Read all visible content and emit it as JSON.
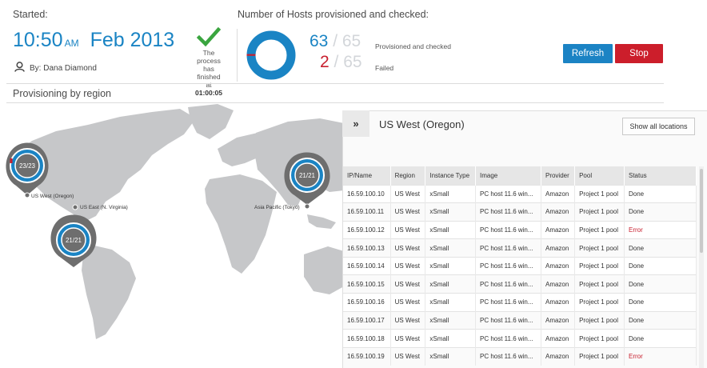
{
  "header": {
    "started_label": "Started:",
    "hosts_label": "Number of Hosts provisioned and checked:",
    "time": "10:50",
    "ampm": "AM",
    "date": "Feb 2013",
    "user": "By: Dana Diamond",
    "finished_line1": "The process",
    "finished_line2": "has finished",
    "finished_line3_prefix": "at",
    "finished_time": "01:00:05"
  },
  "hosts": {
    "provisioned": "63",
    "provisioned_total": "/ 65",
    "provisioned_label": "Provisioned and checked",
    "failed": "2",
    "failed_total": "/ 65",
    "failed_label": "Failed",
    "donut_fraction": 0.969
  },
  "buttons": {
    "refresh": "Refresh",
    "stop": "Stop"
  },
  "section": {
    "provisioning_title": "Provisioning by region"
  },
  "map": {
    "pins": [
      {
        "count": "23/23",
        "label": "US West (Oregon)"
      },
      {
        "count": "21/21",
        "label": "US East (N. Virginia)"
      },
      {
        "count": "21/21",
        "label": "Asia Pacific (Tokyo)"
      }
    ]
  },
  "panel": {
    "expand_glyph": "»",
    "title": "US West (Oregon)",
    "show_all": "Show all locations",
    "columns": [
      "IP/Name",
      "Region",
      "Instance Type",
      "Image",
      "Provider",
      "Pool",
      "Status"
    ],
    "rows": [
      [
        "16.59.100.10",
        "US West",
        "xSmall",
        "PC host 11.6 win...",
        "Amazon",
        "Project 1 pool",
        "Done"
      ],
      [
        "16.59.100.11",
        "US West",
        "xSmall",
        "PC host 11.6 win...",
        "Amazon",
        "Project 1 pool",
        "Done"
      ],
      [
        "16.59.100.12",
        "US West",
        "xSmall",
        "PC host 11.6 win...",
        "Amazon",
        "Project 1 pool",
        "Error"
      ],
      [
        "16.59.100.13",
        "US West",
        "xSmall",
        "PC host 11.6 win...",
        "Amazon",
        "Project 1 pool",
        "Done"
      ],
      [
        "16.59.100.14",
        "US West",
        "xSmall",
        "PC host 11.6 win...",
        "Amazon",
        "Project 1 pool",
        "Done"
      ],
      [
        "16.59.100.15",
        "US West",
        "xSmall",
        "PC host 11.6 win...",
        "Amazon",
        "Project 1 pool",
        "Done"
      ],
      [
        "16.59.100.16",
        "US West",
        "xSmall",
        "PC host 11.6 win...",
        "Amazon",
        "Project 1 pool",
        "Done"
      ],
      [
        "16.59.100.17",
        "US West",
        "xSmall",
        "PC host 11.6 win...",
        "Amazon",
        "Project 1 pool",
        "Done"
      ],
      [
        "16.59.100.18",
        "US West",
        "xSmall",
        "PC host 11.6 win...",
        "Amazon",
        "Project 1 pool",
        "Done"
      ],
      [
        "16.59.100.19",
        "US West",
        "xSmall",
        "PC host 11.6 win...",
        "Amazon",
        "Project 1 pool",
        "Error"
      ]
    ]
  },
  "icons": {
    "user": "user-icon",
    "check": "checkmark-icon",
    "expand": "double-chevron-right-icon"
  },
  "colors": {
    "accent_blue": "#1a84c4",
    "error_red": "#c8202f",
    "check_green": "#3aa53f",
    "map_gray": "#c6c7c9"
  }
}
